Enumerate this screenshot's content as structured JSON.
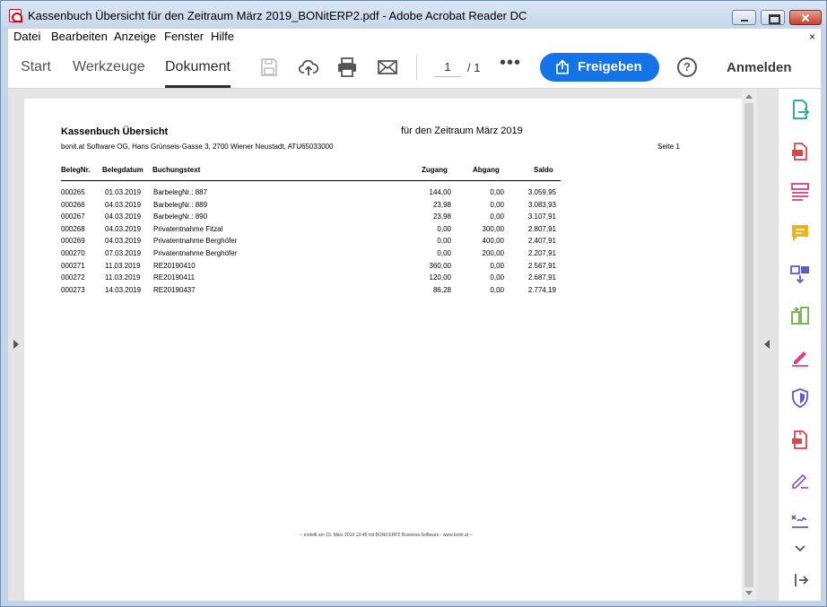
{
  "window": {
    "title": "Kassenbuch Übersicht für den Zeitraum März 2019_BONitERP2.pdf - Adobe Acrobat Reader DC"
  },
  "menu": {
    "items": [
      {
        "label": "Datei"
      },
      {
        "label": "Bearbeiten"
      },
      {
        "label": "Anzeige"
      },
      {
        "label": "Fenster"
      },
      {
        "label": "Hilfe"
      }
    ],
    "close_glyph": "×"
  },
  "toolbar": {
    "tabs": [
      {
        "label": "Start"
      },
      {
        "label": "Werkzeuge"
      },
      {
        "label": "Dokument"
      }
    ],
    "active_tab": "Dokument",
    "page_current": "1",
    "page_total": "/ 1",
    "more": "•••",
    "share_label": "Freigeben",
    "help_glyph": "?",
    "signin_label": "Anmelden",
    "accent_color": "#1473e6"
  },
  "tools_panel": {
    "icons": [
      "export-pdf-icon",
      "create-pdf-icon",
      "edit-pdf-icon",
      "comment-icon",
      "combine-files-icon",
      "organize-pages-icon",
      "redact-icon",
      "protect-icon",
      "compress-pdf-icon",
      "fill-sign-icon",
      "send-for-signature-icon",
      "expand-more-icon",
      "collapse-panel-icon"
    ]
  },
  "pdf": {
    "title": "Kassenbuch Übersicht",
    "period": "für den Zeitraum März 2019",
    "company": "bonit.at Software OG, Hans Grünseis-Gasse 3, 2700 Wiener Neustadt, ATU65033000",
    "page_label": "Seite 1",
    "columns": {
      "nr": "BelegNr.",
      "date": "Belegdatum",
      "text": "Buchungstext",
      "zugang": "Zugang",
      "abgang": "Abgang",
      "saldo": "Saldo"
    },
    "rows": [
      {
        "nr": "000265",
        "date": "01.03.2019",
        "text": "BarbelegNr.: 887",
        "zugang": "144,00",
        "abgang": "0,00",
        "saldo": "3.059,95"
      },
      {
        "nr": "000266",
        "date": "04.03.2019",
        "text": "BarbelegNr.: 889",
        "zugang": "23,98",
        "abgang": "0,00",
        "saldo": "3.083,93"
      },
      {
        "nr": "000267",
        "date": "04.03.2019",
        "text": "BarbelegNr.: 890",
        "zugang": "23,98",
        "abgang": "0,00",
        "saldo": "3.107,91"
      },
      {
        "nr": "000268",
        "date": "04.03.2019",
        "text": "Privatentnahme Fitzal",
        "zugang": "0,00",
        "abgang": "300,00",
        "saldo": "2.807,91"
      },
      {
        "nr": "000269",
        "date": "04.03.2019",
        "text": "Privatentnahme Berghöfer",
        "zugang": "0,00",
        "abgang": "400,00",
        "saldo": "2.407,91"
      },
      {
        "nr": "000270",
        "date": "07.03.2019",
        "text": "Privatentnahme Berghöfer",
        "zugang": "0,00",
        "abgang": "200,00",
        "saldo": "2.207,91"
      },
      {
        "nr": "000271",
        "date": "11.03.2019",
        "text": "RE20190410",
        "zugang": "360,00",
        "abgang": "0,00",
        "saldo": "2.567,91"
      },
      {
        "nr": "000272",
        "date": "11.03.2019",
        "text": "RE20190411",
        "zugang": "120,00",
        "abgang": "0,00",
        "saldo": "2.687,91"
      },
      {
        "nr": "000273",
        "date": "14.03.2019",
        "text": "RE20190437",
        "zugang": "86,28",
        "abgang": "0,00",
        "saldo": "2.774,19"
      }
    ],
    "footer": "-- erstellt am 15. März 2019 13:48 mit BONit ERP2 Business-Software - www.bonit.at --"
  }
}
